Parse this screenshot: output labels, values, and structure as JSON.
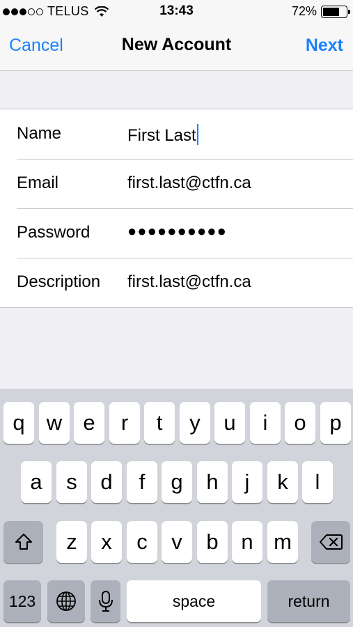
{
  "status_bar": {
    "carrier": "TELUS",
    "time": "13:43",
    "battery_percent": "72%",
    "battery_level": 0.72,
    "signal_bars_filled": 3,
    "signal_bars_total": 5
  },
  "nav": {
    "cancel_label": "Cancel",
    "title": "New Account",
    "next_label": "Next"
  },
  "form": {
    "name": {
      "label": "Name",
      "value": "First Last"
    },
    "email": {
      "label": "Email",
      "value": "first.last@ctfn.ca"
    },
    "password": {
      "label": "Password",
      "value": "●●●●●●●●●●"
    },
    "description": {
      "label": "Description",
      "value": "first.last@ctfn.ca"
    }
  },
  "keyboard": {
    "row1": [
      "q",
      "w",
      "e",
      "r",
      "t",
      "y",
      "u",
      "i",
      "o",
      "p"
    ],
    "row2": [
      "a",
      "s",
      "d",
      "f",
      "g",
      "h",
      "j",
      "k",
      "l"
    ],
    "row3": [
      "z",
      "x",
      "c",
      "v",
      "b",
      "n",
      "m"
    ],
    "numbers_label": "123",
    "space_label": "space",
    "return_label": "return"
  },
  "colors": {
    "accent": "#1a82fb",
    "background": "#efeff4",
    "keyboard_bg": "#d1d4da",
    "dark_key": "#abb0ba"
  }
}
